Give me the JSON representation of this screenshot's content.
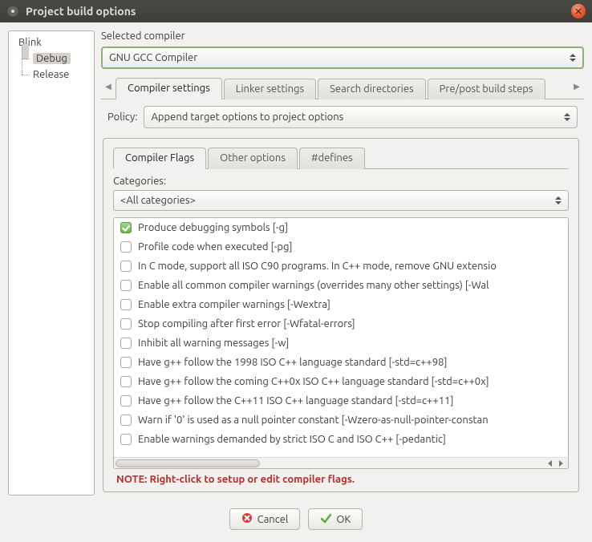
{
  "window": {
    "title": "Project build options"
  },
  "tree": {
    "root": "Blink",
    "children": [
      "Debug",
      "Release"
    ],
    "selected": "Debug"
  },
  "compiler": {
    "label": "Selected compiler",
    "value": "GNU GCC Compiler"
  },
  "top_tabs": {
    "items": [
      "Compiler settings",
      "Linker settings",
      "Search directories",
      "Pre/post build steps"
    ],
    "active": 0
  },
  "policy": {
    "label": "Policy:",
    "value": "Append target options to project options"
  },
  "sub_tabs": {
    "items": [
      "Compiler Flags",
      "Other options",
      "#defines"
    ],
    "active": 0
  },
  "categories": {
    "label": "Categories:",
    "value": "<All categories>"
  },
  "flags": [
    {
      "checked": true,
      "text": "Produce debugging symbols  [-g]"
    },
    {
      "checked": false,
      "text": "Profile code when executed  [-pg]"
    },
    {
      "checked": false,
      "text": "In C mode, support all ISO C90 programs. In C++ mode, remove GNU extensio"
    },
    {
      "checked": false,
      "text": "Enable all common compiler warnings (overrides many other settings)  [-Wal"
    },
    {
      "checked": false,
      "text": "Enable extra compiler warnings  [-Wextra]"
    },
    {
      "checked": false,
      "text": "Stop compiling after first error  [-Wfatal-errors]"
    },
    {
      "checked": false,
      "text": "Inhibit all warning messages  [-w]"
    },
    {
      "checked": false,
      "text": "Have g++ follow the 1998 ISO C++ language standard  [-std=c++98]"
    },
    {
      "checked": false,
      "text": "Have g++ follow the coming C++0x ISO C++ language standard  [-std=c++0x]"
    },
    {
      "checked": false,
      "text": "Have g++ follow the C++11 ISO C++ language standard  [-std=c++11]"
    },
    {
      "checked": false,
      "text": "Warn if '0' is used as a null pointer constant  [-Wzero-as-null-pointer-constan"
    },
    {
      "checked": false,
      "text": "Enable warnings demanded by strict ISO C and ISO C++  [-pedantic]"
    }
  ],
  "note": "NOTE: Right-click to setup or edit compiler flags.",
  "buttons": {
    "cancel": "Cancel",
    "ok": "OK"
  }
}
